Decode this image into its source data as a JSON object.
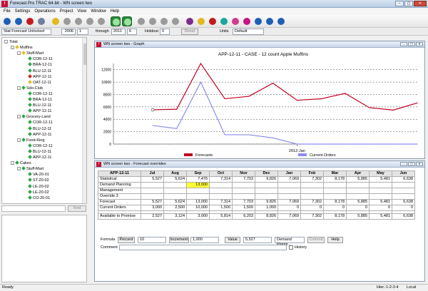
{
  "window": {
    "title": "Forecast Pro TRAC 64-bit - WN screen two",
    "app_icon": "ForecastPro-logo"
  },
  "menu": [
    "File",
    "Settings",
    "Operations",
    "Project",
    "View",
    "Window",
    "Help"
  ],
  "toolbar": {
    "buttons": [
      {
        "icon": "blue-circle-icon",
        "color": "#1f5fb5"
      },
      {
        "icon": "blue-circle-icon",
        "color": "#1f5fb5"
      },
      {
        "icon": "red-circle-icon",
        "color": "#c21b1b"
      },
      {
        "icon": "print-icon",
        "color": "#6e7fa1"
      },
      {
        "icon": "yellow-circle-icon",
        "color": "#e0b820"
      },
      {
        "icon": "grey-circle-icon",
        "color": "#9a9a9a"
      },
      {
        "icon": "grey-circle-icon",
        "color": "#9a9a9a"
      },
      {
        "icon": "grey-circle-icon",
        "color": "#9a9a9a"
      },
      {
        "icon": "grey-circle-icon",
        "color": "#9a9a9a"
      },
      {
        "icon": "green-trend-icon",
        "color": "#1e7a2b"
      },
      {
        "icon": "green-trend-icon",
        "color": "#1e7a2b"
      },
      {
        "icon": "grey-circle-icon",
        "color": "#9a9a9a"
      },
      {
        "icon": "grey-circle-icon",
        "color": "#9a9a9a"
      },
      {
        "icon": "grey-circle-icon",
        "color": "#9a9a9a"
      },
      {
        "icon": "grey-circle-icon",
        "color": "#9a9a9a"
      },
      {
        "icon": "purple-circle-icon",
        "color": "#7a2c8f"
      },
      {
        "icon": "yellow-circle-icon",
        "color": "#e0b820"
      },
      {
        "icon": "red-circle-icon",
        "color": "#c21b1b"
      },
      {
        "icon": "teal-circle-icon",
        "color": "#1aa69a"
      },
      {
        "icon": "pink-circle-icon",
        "color": "#d23c8c"
      },
      {
        "icon": "magenta-circle-icon",
        "color": "#c71585"
      },
      {
        "icon": "blue-circle-icon",
        "color": "#1f5fb5"
      },
      {
        "icon": "blue-circle-icon",
        "color": "#1f5fb5"
      },
      {
        "icon": "blue-circle-icon",
        "color": "#1f5fb5"
      }
    ]
  },
  "params": {
    "status": "Stat Forecast Unlocked",
    "start_year": "2006",
    "start_period": "1",
    "through_label": "through",
    "end_year": "2011",
    "end_period": "6",
    "holdout_label": "Holdout",
    "holdout": "0",
    "reset_label": "Reset",
    "units_label": "Units",
    "units_value": "Default"
  },
  "tree": [
    {
      "label": "Total",
      "level": 0,
      "toggle": "-",
      "dot": ""
    },
    {
      "label": "Muffins",
      "level": 1,
      "toggle": "-",
      "dot": "#e0c020"
    },
    {
      "label": "Stuff-Mart",
      "level": 2,
      "toggle": "-",
      "dot": "#e0c020"
    },
    {
      "label": "COR-12-11",
      "level": 3,
      "toggle": "",
      "dot": "#2aa84a"
    },
    {
      "label": "BRA-12-11",
      "level": 3,
      "toggle": "",
      "dot": "#2aa84a"
    },
    {
      "label": "BLU-12-11",
      "level": 3,
      "toggle": "",
      "dot": "#2aa84a"
    },
    {
      "label": "APP-12-11",
      "level": 3,
      "toggle": "",
      "dot": "#d22020"
    },
    {
      "label": "OAT-12-11",
      "level": 3,
      "toggle": "",
      "dot": "#e0c020"
    },
    {
      "label": "Sdo-Club",
      "level": 2,
      "toggle": "-",
      "dot": "#2aa84a"
    },
    {
      "label": "COR-12-11",
      "level": 3,
      "toggle": "",
      "dot": "#2aa84a"
    },
    {
      "label": "BRA-12-11",
      "level": 3,
      "toggle": "",
      "dot": "#2aa84a"
    },
    {
      "label": "BLU-12-11",
      "level": 3,
      "toggle": "",
      "dot": "#2aa84a"
    },
    {
      "label": "APP-12-11",
      "level": 3,
      "toggle": "",
      "dot": "#2aa84a"
    },
    {
      "label": "Grocery-Land",
      "level": 2,
      "toggle": "-",
      "dot": "#2aa84a"
    },
    {
      "label": "COR-12-11",
      "level": 3,
      "toggle": "",
      "dot": "#2aa84a"
    },
    {
      "label": "BLU-12-11",
      "level": 3,
      "toggle": "",
      "dot": "#2aa84a"
    },
    {
      "label": "APP-12-11",
      "level": 3,
      "toggle": "",
      "dot": "#2aa84a"
    },
    {
      "label": "Food-King",
      "level": 2,
      "toggle": "-",
      "dot": "#2aa84a"
    },
    {
      "label": "COR-12-11",
      "level": 3,
      "toggle": "",
      "dot": "#2aa84a"
    },
    {
      "label": "BLU-12-11",
      "level": 3,
      "toggle": "",
      "dot": "#2aa84a"
    },
    {
      "label": "APP-12-11",
      "level": 3,
      "toggle": "",
      "dot": "#2aa84a"
    },
    {
      "label": "Cakes",
      "level": 1,
      "toggle": "-",
      "dot": "#2aa84a"
    },
    {
      "label": "Stuff-Mart",
      "level": 2,
      "toggle": "-",
      "dot": "#2aa84a"
    },
    {
      "label": "VA-20-01",
      "level": 3,
      "toggle": "",
      "dot": "#2aa84a"
    },
    {
      "label": "ST-20-02",
      "level": 3,
      "toggle": "",
      "dot": "#2aa84a"
    },
    {
      "label": "LE-20-02",
      "level": 3,
      "toggle": "",
      "dot": "#2aa84a"
    },
    {
      "label": "LE-20-02",
      "level": 3,
      "toggle": "",
      "dot": "#2aa84a"
    },
    {
      "label": "CO-20-01",
      "level": 3,
      "toggle": "",
      "dot": "#2aa84a"
    }
  ],
  "find": {
    "button": "Find",
    "value": ""
  },
  "graph_window": {
    "title": "WN screen two - Graph"
  },
  "chart_data": {
    "type": "line",
    "title": "APP-12-11 - CASE - 12 count Apple Muffins",
    "xlabel": "",
    "ylabel": "",
    "x_tick_label": "2012-Jan",
    "y_ticks": [
      0,
      2000,
      4000,
      6000,
      8000,
      10000,
      12000
    ],
    "ylim": [
      0,
      13000
    ],
    "grid": true,
    "legend_position": "bottom",
    "series": [
      {
        "name": "Forecasts",
        "color": "#c00020",
        "values": [
          5527,
          5624,
          13000,
          7314,
          7703,
          9826,
          7069,
          7302,
          8178,
          5885,
          5481,
          6638
        ]
      },
      {
        "name": "Current Orders",
        "color": "#8c8cf0",
        "values": [
          3000,
          2500,
          10000,
          1500,
          1500,
          1000,
          0,
          0,
          0,
          0,
          0,
          0
        ]
      }
    ]
  },
  "override_window": {
    "title": "WN screen two - Forecast overrides"
  },
  "grid": {
    "item": "APP-12-11",
    "months": [
      "Jul",
      "Aug",
      "Sep",
      "Oct",
      "Nov",
      "Dec",
      "Jan",
      "Feb",
      "Mar",
      "Apr",
      "May",
      "Jun"
    ],
    "rows": [
      {
        "label": "Statistical",
        "cells": [
          "5,527",
          "5,624",
          "7,476",
          "7,314",
          "7,703",
          "9,826",
          "7,069",
          "7,302",
          "8,178",
          "5,885",
          "5,481",
          "6,638"
        ]
      },
      {
        "label": "Demand Planning",
        "cells": [
          "",
          "",
          "13,000",
          "",
          "",
          "",
          "",
          "",
          "",
          "",
          "",
          ""
        ],
        "highlight": 2
      },
      {
        "label": "Management",
        "cells": [
          "",
          "",
          "",
          "",
          "",
          "",
          "",
          "",
          "",
          "",
          "",
          ""
        ]
      },
      {
        "label": "Override 3",
        "cells": [
          "",
          "",
          "",
          "",
          "",
          "",
          "",
          "",
          "",
          "",
          "",
          ""
        ]
      },
      {
        "label": "Forecast",
        "cells": [
          "5,527",
          "5,624",
          "13,000",
          "7,314",
          "7,703",
          "9,826",
          "7,069",
          "7,302",
          "8,178",
          "5,885",
          "5,481",
          "6,638"
        ]
      },
      {
        "label": "Current Orders",
        "cells": [
          "3,000",
          "2,500",
          "10,000",
          "1,500",
          "1,500",
          "1,000",
          "0",
          "0",
          "0",
          "0",
          "0",
          "0"
        ]
      },
      {
        "label": "",
        "cells": [
          "",
          "",
          "",
          "",
          "",
          "",
          "",
          "",
          "",
          "",
          "",
          ""
        ],
        "blank": true
      },
      {
        "label": "Available to Promise",
        "cells": [
          "2,527",
          "3,124",
          "3,000",
          "5,814",
          "6,203",
          "8,826",
          "7,069",
          "7,302",
          "8,178",
          "5,885",
          "5,481",
          "6,638"
        ]
      }
    ]
  },
  "formula": {
    "label": "Formula",
    "percent_btn": "Percent",
    "percent_val": "10",
    "increment_btn": "Increment",
    "increment_val": "1,000",
    "value_btn": "Value",
    "value_val": "5,527",
    "dropdown": "Demand Planni...",
    "commit_btn": "Commit",
    "help_btn": "Help",
    "comment_label": "Comment",
    "history_label": "History"
  },
  "status": {
    "left": "Ready",
    "hier": "Hier.:1-2-3-4",
    "local": "Local"
  }
}
